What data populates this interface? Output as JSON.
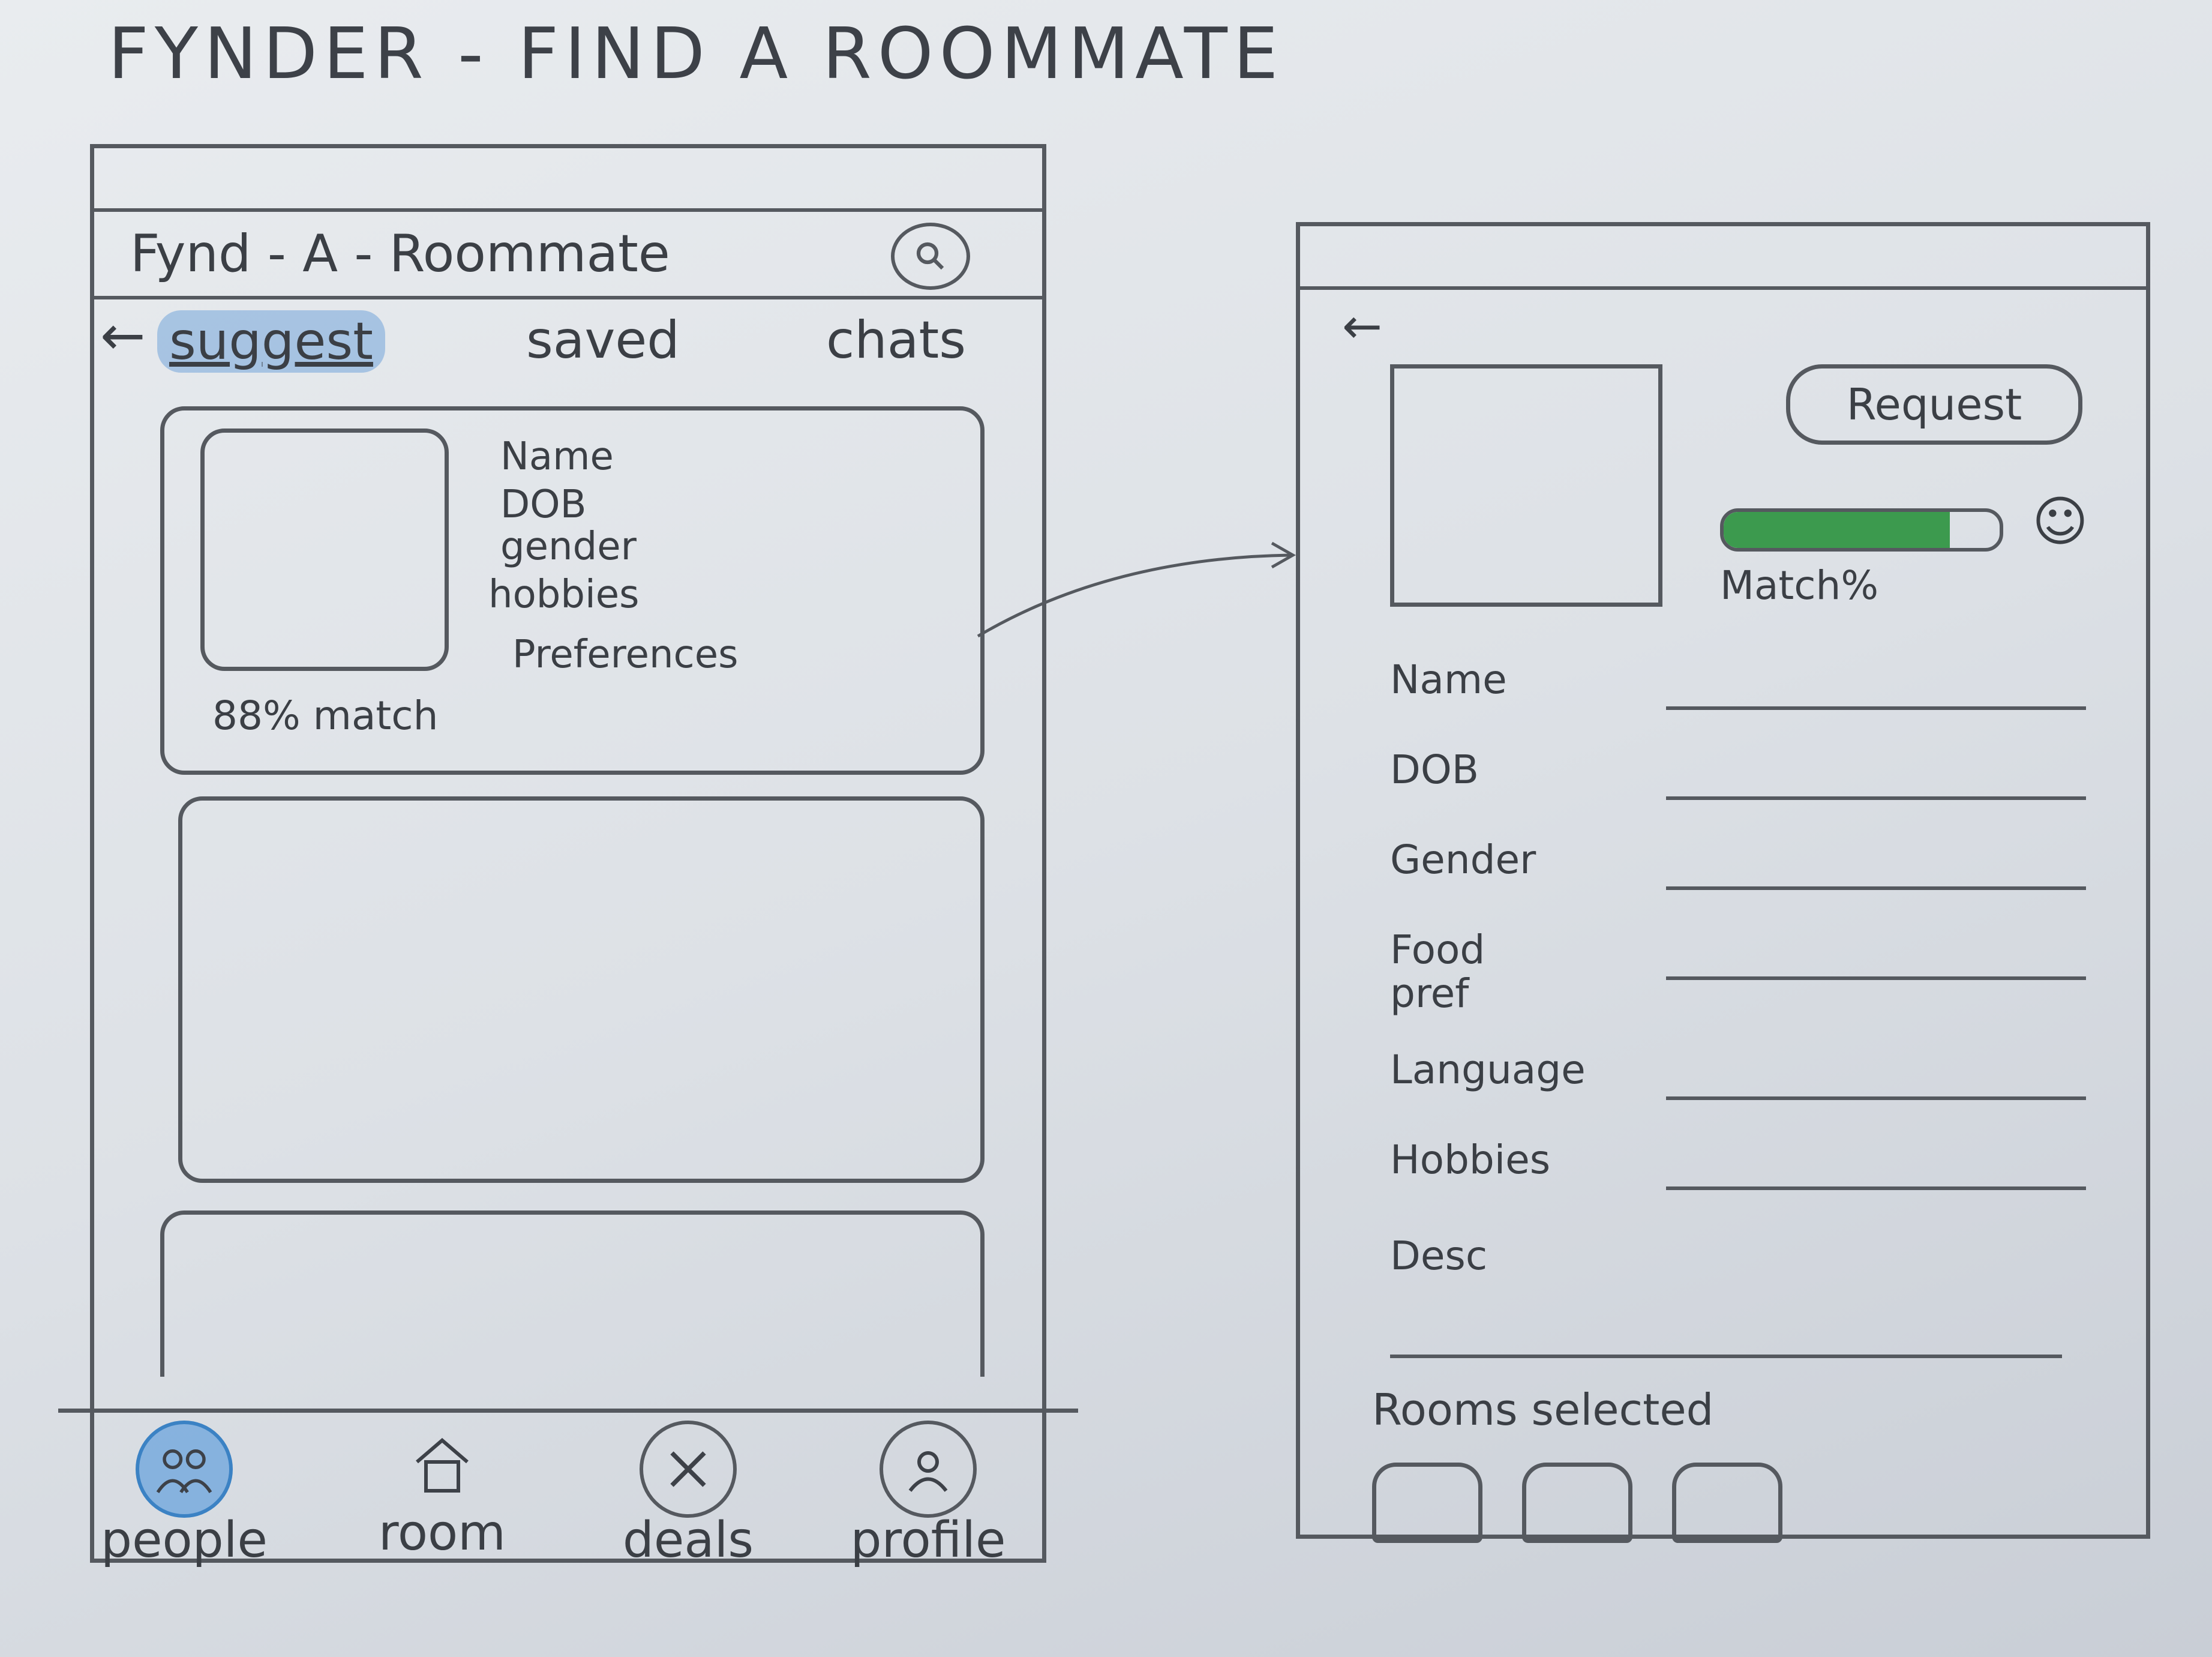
{
  "sheet_title": "FYNDER - FIND A ROOMMATE",
  "list_screen": {
    "app_title": "Fynd - A - Roommate",
    "search_icon": "search-icon",
    "back_icon": "back-arrow-icon",
    "tabs": [
      {
        "label": "suggest",
        "active": true
      },
      {
        "label": "saved",
        "active": false
      },
      {
        "label": "chats",
        "active": false
      }
    ],
    "card": {
      "match": "88% match",
      "fields": [
        "Name",
        "DOB",
        "gender",
        "hobbies",
        "Preferences"
      ]
    },
    "nav": [
      {
        "label": "people",
        "icon": "people-icon",
        "active": true
      },
      {
        "label": "room",
        "icon": "home-icon",
        "active": false
      },
      {
        "label": "deals",
        "icon": "deals-icon",
        "active": false
      },
      {
        "label": "profile",
        "icon": "profile-icon",
        "active": false
      }
    ]
  },
  "detail_screen": {
    "back_icon": "back-arrow-icon",
    "request_label": "Request",
    "match_label": "Match%",
    "match_fraction": 0.82,
    "smiley_icon": "smiley-icon",
    "fields": [
      "Name",
      "DOB",
      "Gender",
      "Food pref",
      "Language",
      "Hobbies",
      "Desc"
    ],
    "rooms_label": "Rooms selected",
    "accent_colors": {
      "match_fill": "#3c9a4e",
      "active_tab": "#5a96d7"
    }
  }
}
